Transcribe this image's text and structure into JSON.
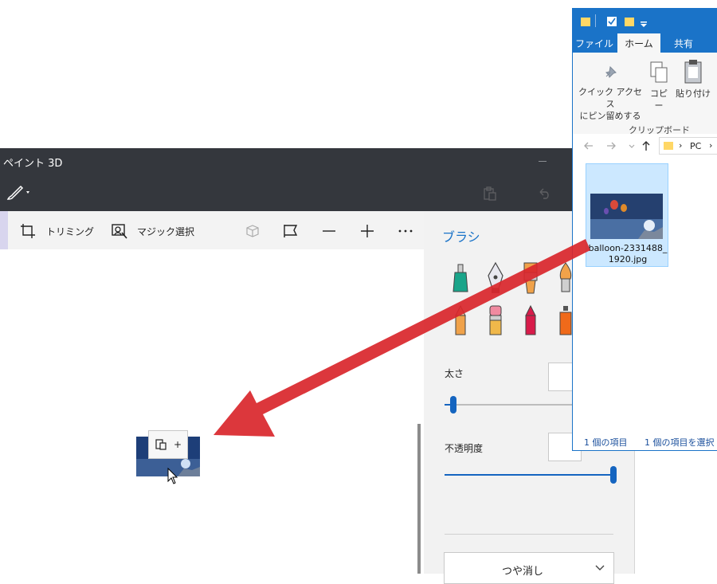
{
  "paint3d": {
    "title": "ペイント 3D",
    "toolbar": {
      "crop_label": "トリミング",
      "magic_select_label": "マジック選択"
    },
    "brush_panel": {
      "title": "ブラシ",
      "brushes": [
        "marker",
        "calligraphy-pen",
        "oil-brush",
        "watercolor",
        "pencil",
        "eraser",
        "crayon",
        "spray-can"
      ],
      "size_label": "太さ",
      "size_value": "",
      "size_level": 0.05,
      "opacity_label": "不透明度",
      "opacity_value": "",
      "opacity_level": 1.0,
      "finish_value": "つや消し"
    },
    "drop_tooltip": {
      "icon": "paste-icon",
      "plus": "+"
    }
  },
  "explorer": {
    "tabs": [
      "ファイル",
      "ホーム",
      "共有"
    ],
    "active_tab": "ホーム",
    "ribbon": {
      "pin_label_1": "クイック アクセス",
      "pin_label_2": "にピン留めする",
      "copy_label": "コピー",
      "paste_label": "貼り付け",
      "group_label": "クリップボード"
    },
    "address": {
      "separator": "›",
      "location": "PC"
    },
    "file": {
      "name_1": "balloon-2331488_",
      "name_2": "1920.jpg"
    },
    "status": {
      "items": "1 個の項目",
      "selected": "1 個の項目を選択"
    }
  },
  "colors": {
    "paint_titlebar": "#34373d",
    "explorer_accent": "#1a73c8",
    "selection": "#cce8ff",
    "annotation_arrow": "#d9262b"
  }
}
